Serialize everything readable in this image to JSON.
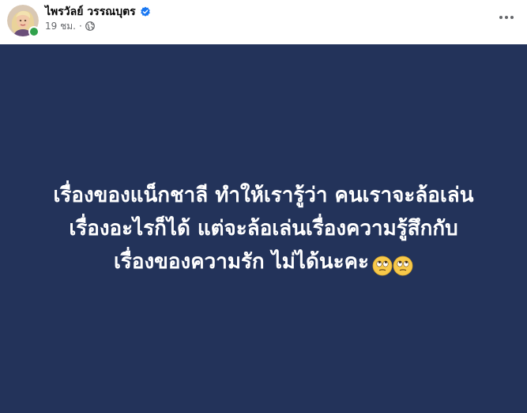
{
  "post": {
    "author_name": "ไพรวัลย์ วรรณบุตร",
    "verified_icon": "verified-badge-icon",
    "timestamp": "19 ชม.",
    "separator": "·",
    "audience_icon": "globe-icon",
    "more_icon": "more-options-icon"
  },
  "status": {
    "background_color": "#23335a",
    "text_color": "#ffffff",
    "lines": [
      "เรื่องของแน็กชาลี ทำให้เรารู้ว่า คนเราจะล้อเล่น",
      "เรื่องอะไรก็ได้ แต่จะล้อเล่นเรื่องความรู้สึกกับ",
      "เรื่องของความรัก ไม่ได้นะคะ"
    ],
    "emojis": [
      "face-with-rolling-eyes-icon",
      "face-with-rolling-eyes-icon"
    ]
  },
  "colors": {
    "verified_blue": "#1877f2",
    "online_green": "#31a24c",
    "meta_gray": "#65676b"
  }
}
